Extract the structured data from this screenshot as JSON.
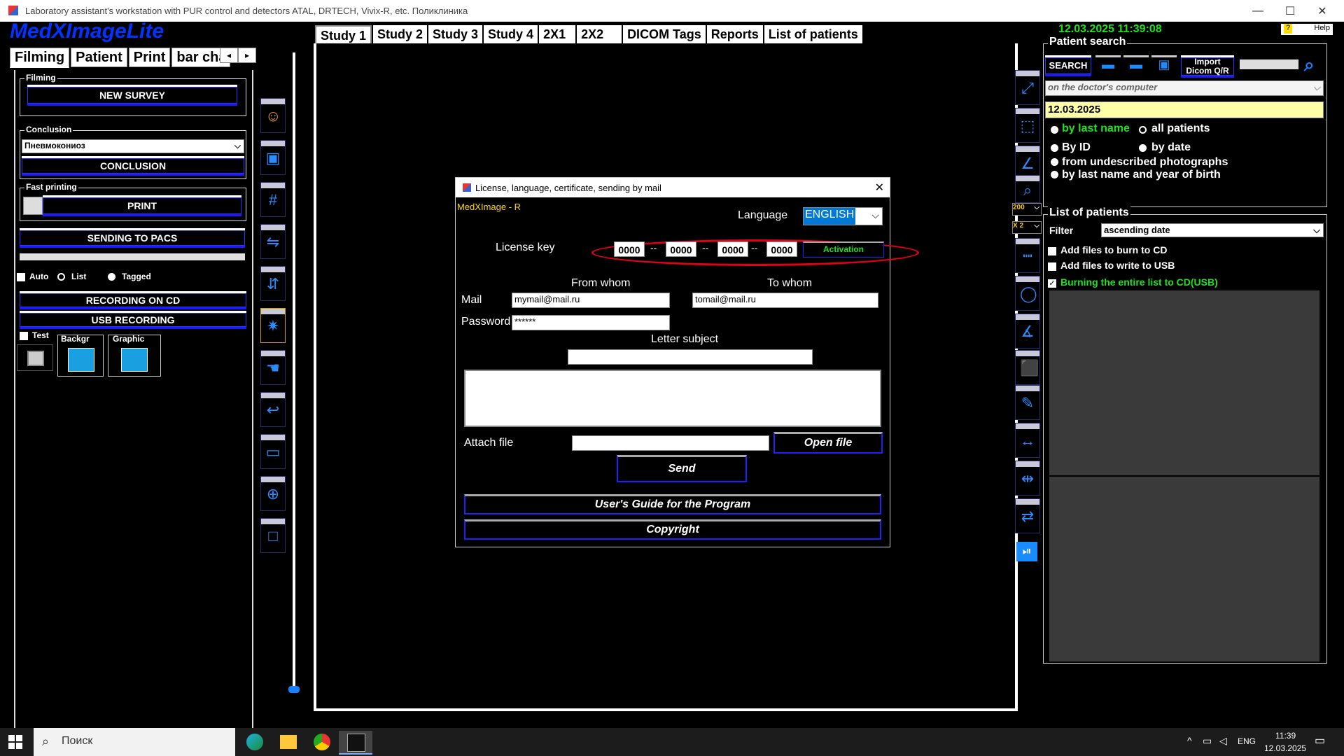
{
  "window": {
    "title": "Laboratory assistant's workstation with PUR control and detectors ATAL, DRTECH, Vivix-R, etc.  Поликлиника",
    "controls": [
      "—",
      "☐",
      "✕"
    ]
  },
  "app": {
    "logo": "MedXImageLite",
    "datetime": "12.03.2025 11:39:08",
    "help": "Help"
  },
  "left_tabs": [
    "Filming",
    "Patient",
    "Print",
    "bar char"
  ],
  "left_tab_arrows": [
    "◂",
    "▸"
  ],
  "filming": {
    "legend": "Filming",
    "new_survey": "NEW SURVEY",
    "conclusion_legend": "Conclusion",
    "conclusion_value": "Пневмокониоз",
    "conclusion_btn": "CONCLUSION",
    "fast_printing_legend": "Fast printing",
    "print_btn": "PRINT",
    "send_pacs": "SENDING TO PACS",
    "auto": "Auto",
    "list": "List",
    "tagged": "Tagged",
    "record_cd": "RECORDING ON CD",
    "usb_record": "USB RECORDING",
    "test": "Test",
    "backgr": "Backgr",
    "graphic": "Graphic"
  },
  "study_tabs": [
    "Study 1",
    "Study 2",
    "Study 3",
    "Study 4",
    "2X1",
    "2X2",
    "DICOM Tags",
    "Reports",
    "List of patients"
  ],
  "patient_search": {
    "legend": "Patient search",
    "search_btn": "SEARCH",
    "import_btn_line1": "Import",
    "import_btn_line2": "Dicom Q/R",
    "location": "on the doctor's computer",
    "date": "12.03.2025",
    "opt_last_name": "by last name",
    "opt_all": "all patients",
    "opt_id": "By ID",
    "opt_date": "by date",
    "opt_undescribed": "from undescribed photographs",
    "opt_name_year": "by last name and year of birth"
  },
  "list_of_patients": {
    "legend": "List of patients",
    "filter_label": "Filter",
    "filter_value": "ascending date",
    "add_cd": "Add files to burn to CD",
    "add_usb": "Add files to write to USB",
    "burn_all": "Burning the entire list to CD(USB)"
  },
  "right_zoom": {
    "zoom": "200",
    "mult": "X 2"
  },
  "dialog": {
    "title": "License, language, certificate, sending by mail",
    "product": "MedXImage - R",
    "language_label": "Language",
    "language_value": "ENGLISH",
    "license_label": "License key",
    "license_parts": [
      "0000",
      "0000",
      "0000",
      "0000"
    ],
    "license_sep": "--",
    "activation": "Activation",
    "from_whom": "From whom",
    "to_whom": "To whom",
    "mail_label": "Mail",
    "mail_from": "mymail@mail.ru",
    "mail_to": "tomail@mail.ru",
    "password_label": "Password",
    "password_value": "******",
    "subject_label": "Letter subject",
    "subject_value": "",
    "body_value": "",
    "attach_label": "Attach file",
    "attach_value": "",
    "open_file": "Open file",
    "send": "Send",
    "guide": "User's Guide for the Program",
    "copyright": "Copyright",
    "close": "✕"
  },
  "taskbar": {
    "search_placeholder": "Поиск",
    "lang": "ENG",
    "time": "11:39",
    "date": "12.03.2025"
  },
  "colors": {
    "accent_blue": "#1a1aff",
    "green": "#1fe21f",
    "yellow": "#ffff99",
    "annotation_red": "#e0001a"
  }
}
